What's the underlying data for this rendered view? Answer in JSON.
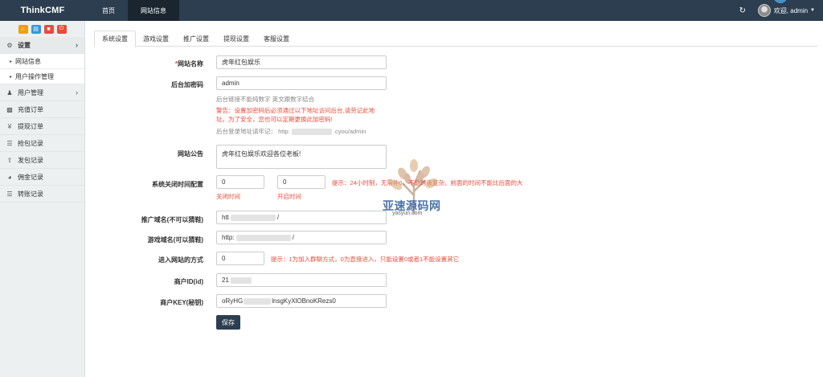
{
  "app": {
    "brand": "ThinkCMF"
  },
  "topnav": [
    {
      "label": "首页",
      "active": false
    },
    {
      "label": "网站信息",
      "active": true
    }
  ],
  "header_right": {
    "refresh_icon": "refresh-icon",
    "user_label": "欢迎, admin"
  },
  "sidebar": {
    "shortcuts": [
      "home-icon",
      "file-icon",
      "trash-icon",
      "power-icon"
    ],
    "groups": [
      {
        "label": "设置",
        "icon": "gears-icon",
        "expanded": true
      },
      {
        "label": "用户管理",
        "icon": "users-icon"
      }
    ],
    "sub_items": [
      "网站信息",
      "用户操作管理"
    ],
    "items": [
      {
        "label": "充值订单",
        "icon": "chart-icon"
      },
      {
        "label": "提现订单",
        "icon": "yen-icon"
      },
      {
        "label": "抢包记录",
        "icon": "list-icon"
      },
      {
        "label": "发包记录",
        "icon": "upload-icon"
      },
      {
        "label": "佣金记录",
        "icon": "pie-icon"
      },
      {
        "label": "转账记录",
        "icon": "list-icon"
      }
    ]
  },
  "tabs": [
    "系统设置",
    "游戏设置",
    "推广设置",
    "提现设置",
    "客服设置"
  ],
  "form": {
    "site_name": {
      "label": "网站名称",
      "required_mark": "*",
      "value": "虎年红包娱乐"
    },
    "admin_code": {
      "label": "后台加密码",
      "value": "admin",
      "help": "后台链接不能纯数字 英文跟数字结合",
      "warning_line1": "警告：设置加密码后必须通过以下地址访问后台,请劳记此地",
      "warning_line2": "址。为了安全，您也可以定期更换此加密码!",
      "url_prefix": "后台登录地址请牢记：  http:",
      "url_suffix": ".cyou/admin"
    },
    "notice": {
      "label": "网站公告",
      "value": "虎年红包娱乐欢迎各位老板!"
    },
    "close_time": {
      "label": "系统关闭时间配置",
      "close_value": "0",
      "open_value": "0",
      "close_label": "关闭时间",
      "open_label": "开启时间",
      "tip": "提示：24小时制，无需补0，不能跨夜复杂。前面的时间不能比后面的大"
    },
    "promo_domain": {
      "label": "推广域名(不可以猜鞋)",
      "value_prefix": "htt",
      "value_suffix": "/"
    },
    "game_domain": {
      "label": "游戏域名(可以猜鞋)",
      "value_prefix": "http:",
      "value_suffix": "/"
    },
    "enter_mode": {
      "label": "进入网站的方式",
      "value": "0",
      "tip": "提示：1为加入群聊方式，0为直接进入，只能设置0或者1不能设置其它"
    },
    "merchant_id": {
      "label": "商户ID(id)",
      "value_prefix": "21"
    },
    "merchant_key": {
      "label": "商户KEY(秘钥)",
      "value_prefix": "oRyHG",
      "value_suffix": "lnsgKyXlOBnoKRezs0"
    },
    "save_label": "保存"
  },
  "watermark": {
    "text": "亚速源码网",
    "sub": "yasyun.com"
  },
  "colors": {
    "topbar": "#2c3e50",
    "accent_red": "#e74c3c",
    "sidebar_bg": "#ecf0f1"
  }
}
